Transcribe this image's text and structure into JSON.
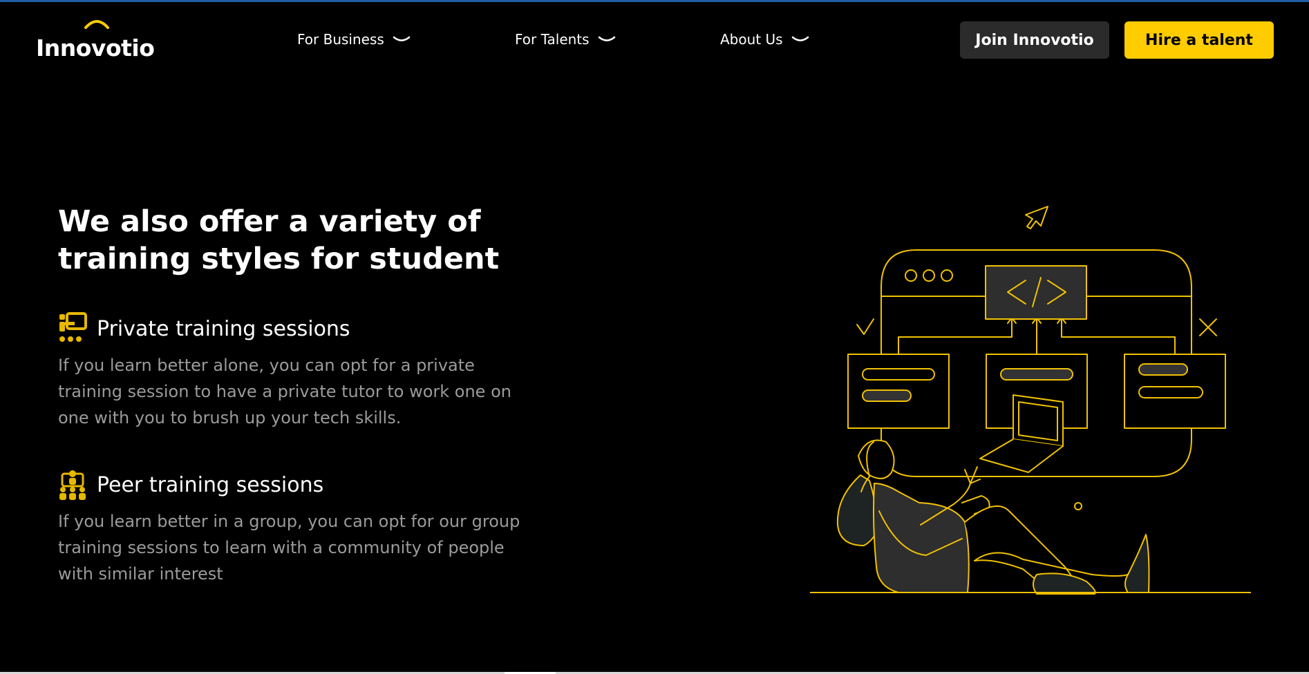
{
  "header": {
    "logo_text": "Innovotio",
    "nav": [
      {
        "label": "For Business",
        "icon": "chevron-down-icon"
      },
      {
        "label": "For Talents",
        "icon": "chevron-down-icon"
      },
      {
        "label": "About Us",
        "icon": "chevron-down-icon"
      }
    ],
    "join_label": "Join Innovotio",
    "hire_label": "Hire a talent"
  },
  "hero": {
    "headline_line1": "We also offer a variety of",
    "headline_line2": "training styles for student",
    "features": [
      {
        "icon": "private-training-icon",
        "title": "Private training sessions",
        "description": "If you learn better alone, you can opt for a private training session to have a private tutor to work one on one with you to brush up your tech skills."
      },
      {
        "icon": "peer-training-icon",
        "title": "Peer training sessions",
        "description": "If you learn better in a group, you can opt for our group training sessions to learn with a community of people with similar interest"
      }
    ],
    "illustration": {
      "name": "coding-workflow-illustration",
      "code_symbol": "</>"
    }
  },
  "colors": {
    "background": "#000000",
    "accent": "#ffcc00",
    "button_dark": "#2b2b2b",
    "body_text": "#9b9b9b"
  }
}
